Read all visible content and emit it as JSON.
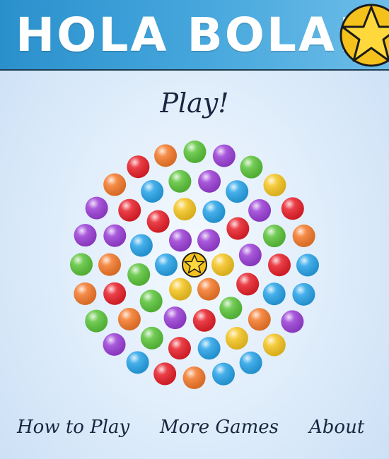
{
  "header": {
    "title": "HOLA BOLA!",
    "logo_icon": "star-ball-icon"
  },
  "menu": {
    "play_label": "Play!"
  },
  "footer": {
    "how_to_play": "How to Play",
    "more_games": "More Games",
    "about": "About"
  },
  "board": {
    "center_icon": "star-icon",
    "ball_colors": {
      "red": "#e8202a",
      "orange": "#f4792a",
      "yellow": "#f5c520",
      "green": "#5bc43a",
      "blue": "#27a3e8",
      "purple": "#9b3fd6"
    },
    "rings": [
      [
        "yellow",
        "orange",
        "yellow",
        "blue",
        "purple",
        "purple"
      ],
      [
        "red",
        "green",
        "red",
        "purple",
        "green",
        "green",
        "blue",
        "red",
        "yellow",
        "blue",
        "red",
        "purple"
      ],
      [
        "orange",
        "yellow",
        "blue",
        "red",
        "green",
        "orange",
        "red",
        "orange",
        "purple",
        "red",
        "blue",
        "green",
        "purple",
        "blue",
        "purple",
        "green",
        "red",
        "blue"
      ],
      [
        "blue",
        "blue",
        "orange",
        "red",
        "blue",
        "purple",
        "green",
        "orange",
        "green",
        "purple",
        "purple",
        "orange",
        "red",
        "orange",
        "green",
        "purple",
        "green",
        "yellow",
        "red",
        "orange",
        "blue",
        "blue",
        "purple",
        "yellow"
      ]
    ]
  }
}
